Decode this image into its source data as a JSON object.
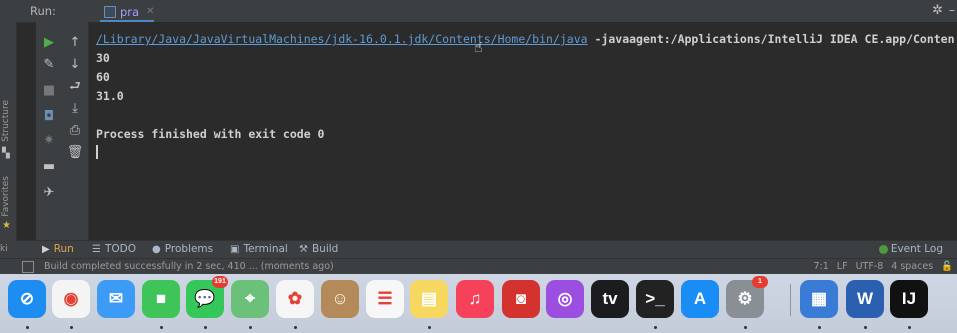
{
  "run_header": {
    "title": "Run:",
    "tab_label": "pra"
  },
  "side_tabs": {
    "structure": "Structure",
    "favorites": "Favorites",
    "side_letter": "ki"
  },
  "console": {
    "command_link": "/Library/Java/JavaVirtualMachines/jdk-16.0.1.jdk/Contents/Home/bin/java",
    "command_rest": " -javaagent:/Applications/IntelliJ IDEA CE.app/Conten",
    "output_lines": [
      "30",
      "60",
      "31.0"
    ],
    "exit_message": "Process finished with exit code 0"
  },
  "bottom_tabs": {
    "run": "Run",
    "todo": "TODO",
    "problems": "Problems",
    "terminal": "Terminal",
    "build": "Build",
    "event_log": "Event Log"
  },
  "status_bar": {
    "message": "Build completed successfully in 2 sec, 410 ... (moments ago)",
    "position": "7:1",
    "line_sep": "LF",
    "encoding": "UTF-8",
    "indent": "4 spaces"
  },
  "dock": {
    "apps": [
      {
        "name": "Safari",
        "glyph": "⊘",
        "color": "#1e8df2"
      },
      {
        "name": "Chrome",
        "glyph": "◉",
        "color": "#f4f4f4"
      },
      {
        "name": "Mail",
        "glyph": "✉",
        "color": "#3b9bf5"
      },
      {
        "name": "FaceTime",
        "glyph": "■",
        "color": "#3fc45a"
      },
      {
        "name": "Messages",
        "glyph": "💬",
        "color": "#36c75a",
        "badge": "191"
      },
      {
        "name": "Maps",
        "glyph": "⌖",
        "color": "#6cc17a"
      },
      {
        "name": "Photos",
        "glyph": "✿",
        "color": "#f5f5f5"
      },
      {
        "name": "Contacts",
        "glyph": "☺",
        "color": "#b48a5a"
      },
      {
        "name": "Reminders",
        "glyph": "☰",
        "color": "#f7f7f7"
      },
      {
        "name": "Notes",
        "glyph": "▤",
        "color": "#f6d860"
      },
      {
        "name": "Music",
        "glyph": "♫",
        "color": "#f5425a"
      },
      {
        "name": "Photo Booth",
        "glyph": "◙",
        "color": "#d3322f"
      },
      {
        "name": "Podcasts",
        "glyph": "◎",
        "color": "#9b4ee0"
      },
      {
        "name": "TV",
        "glyph": "tv",
        "color": "#1c1c1e"
      },
      {
        "name": "Terminal",
        "glyph": ">_",
        "color": "#222222"
      },
      {
        "name": "App Store",
        "glyph": "A",
        "color": "#1a8cf5"
      },
      {
        "name": "System Preferences",
        "glyph": "⚙",
        "color": "#8a8f96",
        "badge": "1"
      },
      {
        "name": "Preview",
        "glyph": "▦",
        "color": "#3a7bd5"
      },
      {
        "name": "Word",
        "glyph": "W",
        "color": "#2b5faf"
      },
      {
        "name": "IntelliJ IDEA",
        "glyph": "IJ",
        "color": "#111111"
      }
    ]
  },
  "colors": {
    "link": "#5d9bd4",
    "accent": "#4a88c7",
    "ide_bg": "#2b2b2b",
    "panel_bg": "#3c3f41"
  }
}
